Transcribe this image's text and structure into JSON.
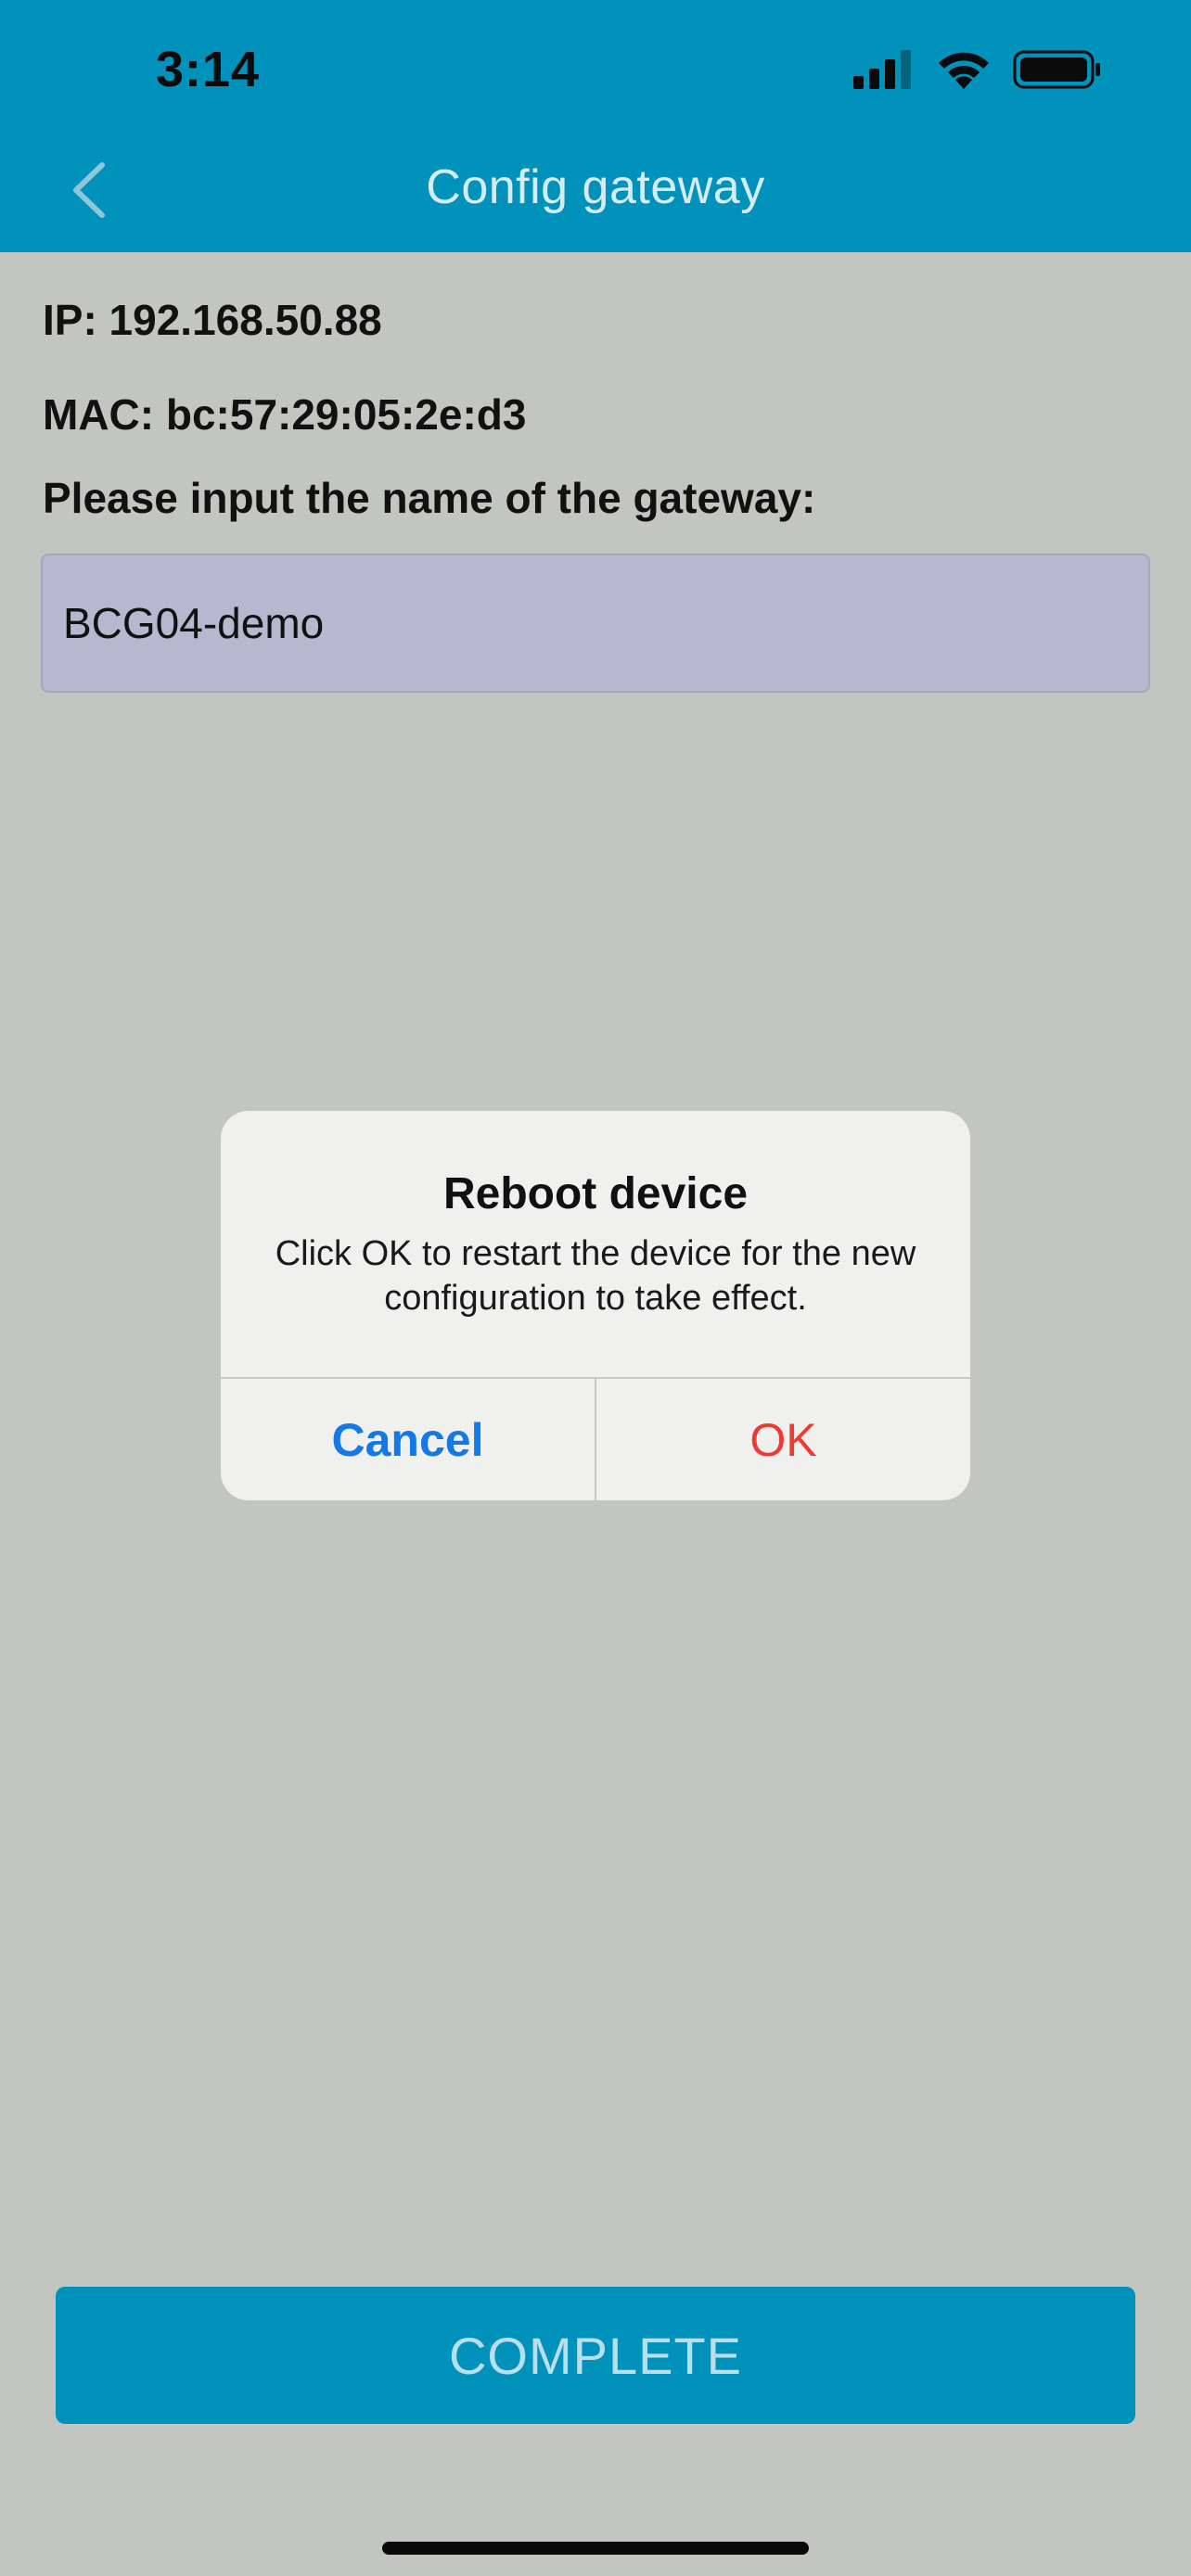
{
  "status_bar": {
    "time": "3:14",
    "icons": [
      "signal-icon",
      "wifi-icon",
      "battery-icon"
    ]
  },
  "nav": {
    "title": "Config gateway",
    "back_icon": "chevron-left-icon"
  },
  "content": {
    "ip_text": "IP: 192.168.50.88",
    "mac_text": "MAC: bc:57:29:05:2e:d3",
    "name_prompt": "Please input the name of the gateway:",
    "gateway_name_value": "BCG04-demo"
  },
  "dialog": {
    "title": "Reboot device",
    "message": "Click OK to restart the device for the new configuration to take effect.",
    "cancel_label": "Cancel",
    "ok_label": "OK"
  },
  "footer": {
    "complete_label": "COMPLETE"
  },
  "colors": {
    "header_bg": "#0092bb",
    "screen_bg": "#c3c5c1",
    "input_bg": "#b5b8ce",
    "cancel_blue": "#1479e6",
    "ok_red": "#ed3b32"
  }
}
